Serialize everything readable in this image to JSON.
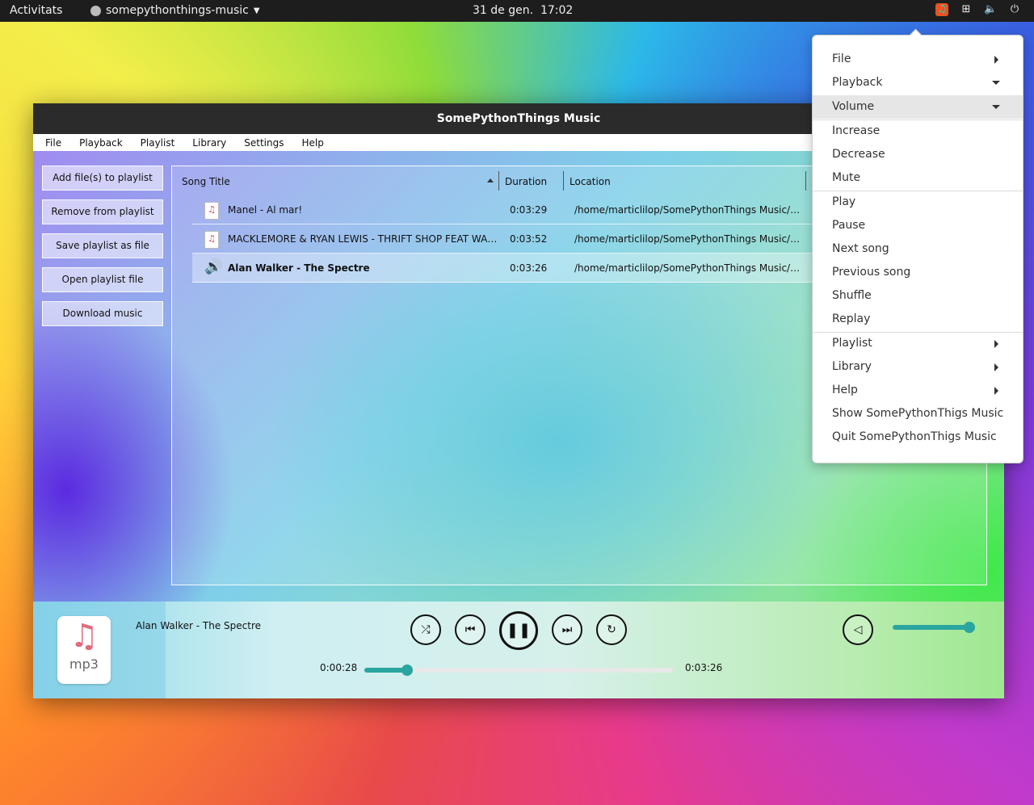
{
  "topbar": {
    "activities": "Activitats",
    "app_name": "somepythonthings-music",
    "date": "31 de gen.",
    "time": "17:02",
    "tray_icons": [
      "music-tray-icon",
      "network-icon",
      "volume-icon",
      "power-icon"
    ]
  },
  "window": {
    "title": "SomePythonThings Music",
    "menu": [
      "File",
      "Playback",
      "Playlist",
      "Library",
      "Settings",
      "Help"
    ]
  },
  "sidebar": {
    "buttons": [
      "Add file(s) to playlist",
      "Remove from playlist",
      "Save playlist as file",
      "Open playlist file",
      "Download music"
    ]
  },
  "table": {
    "columns": [
      "Song Title",
      "Duration",
      "Location"
    ],
    "rows": [
      {
        "title": "Manel - Al mar!",
        "duration": "0:03:29",
        "location": "/home/marticlilop/SomePythonThings Music/Ma..."
      },
      {
        "title": "MACKLEMORE & RYAN LEWIS - THRIFT SHOP FEAT WANZ ...",
        "duration": "0:03:52",
        "location": "/home/marticlilop/SomePythonThings Music/MA..."
      },
      {
        "title": "Alan Walker - The Spectre",
        "duration": "0:03:26",
        "location": "/home/marticlilop/SomePythonThings Music/Ala..."
      }
    ]
  },
  "player": {
    "cover_ext": "mp3",
    "now_playing": "Alan Walker - The Spectre",
    "elapsed": "0:00:28",
    "total": "0:03:26",
    "progress_fraction": 0.14,
    "volume_fraction": 0.95,
    "accent": "#2aa5a0"
  },
  "tray_menu": {
    "items": [
      {
        "label": "File",
        "submenu": "right"
      },
      {
        "label": "Playback",
        "submenu": "down"
      },
      {
        "label": "Volume",
        "submenu": "down",
        "highlighted": true
      },
      {
        "label": "Increase"
      },
      {
        "label": "Decrease"
      },
      {
        "label": "Mute"
      },
      {
        "label": "Play"
      },
      {
        "label": "Pause"
      },
      {
        "label": "Next song"
      },
      {
        "label": "Previous song"
      },
      {
        "label": "Shuffle"
      },
      {
        "label": "Replay"
      },
      {
        "label": "Playlist",
        "submenu": "right"
      },
      {
        "label": "Library",
        "submenu": "right"
      },
      {
        "label": "Help",
        "submenu": "right"
      },
      {
        "label": "Show SomePythonThigs Music"
      },
      {
        "label": "Quit SomePythonThigs Music"
      }
    ]
  }
}
